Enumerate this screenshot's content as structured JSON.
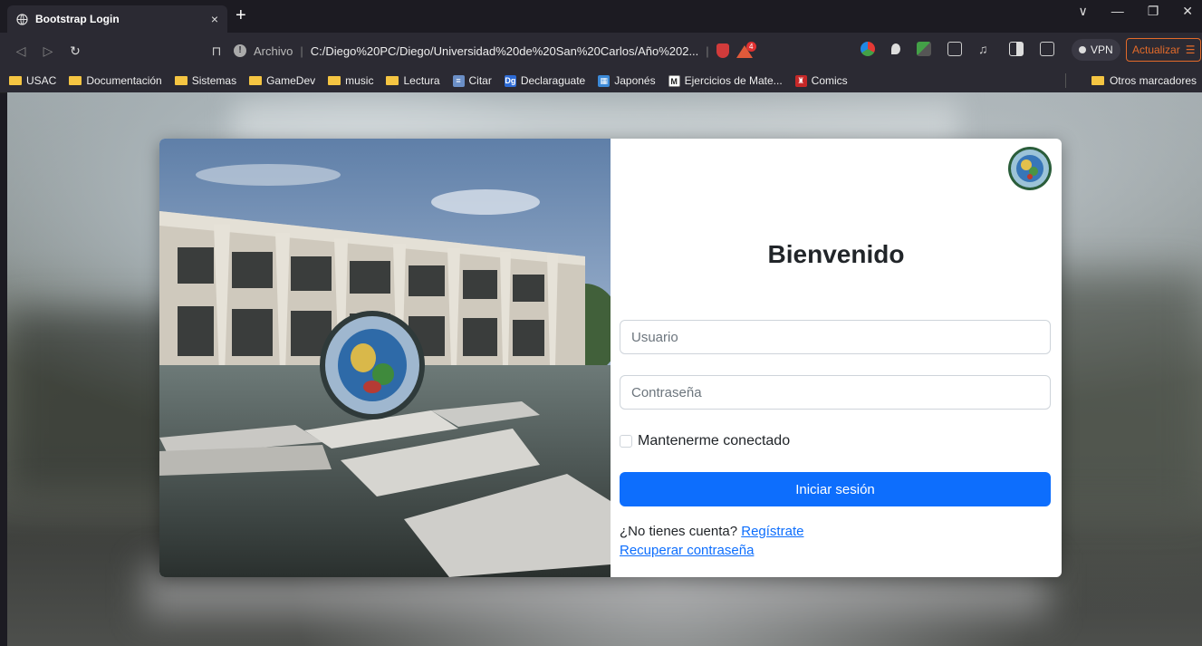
{
  "browser": {
    "tab_title": "Bootstrap Login",
    "tab_close": "×",
    "new_tab": "+",
    "url_label": "Archivo",
    "url_separator": "|",
    "url": "C:/Diego%20PC/Diego/Universidad%20de%20San%20Carlos/Año%202...",
    "brave_badge_count": "4",
    "vpn_label": "VPN",
    "update_label": "Actualizar",
    "window_controls": [
      "∨",
      "—",
      "❐",
      "✕"
    ],
    "bookmarks": [
      {
        "label": "USAC",
        "icon": "folder-icon"
      },
      {
        "label": "Documentación",
        "icon": "folder-icon"
      },
      {
        "label": "Sistemas",
        "icon": "folder-icon"
      },
      {
        "label": "GameDev",
        "icon": "folder-icon"
      },
      {
        "label": "music",
        "icon": "folder-icon"
      },
      {
        "label": "Lectura",
        "icon": "folder-icon"
      },
      {
        "label": "Citar",
        "icon": "citar-icon"
      },
      {
        "label": "Declaraguate",
        "icon": "declaraguate-icon"
      },
      {
        "label": "Japonés",
        "icon": "japones-icon"
      },
      {
        "label": "Ejercicios de Mate...",
        "icon": "m-icon"
      },
      {
        "label": "Comics",
        "icon": "comics-icon"
      }
    ],
    "other_bookmarks": "Otros marcadores"
  },
  "login": {
    "title": "Bienvenido",
    "username_placeholder": "Usuario",
    "password_placeholder": "Contraseña",
    "remember_label": "Mantenerme conectado",
    "submit_label": "Iniciar sesión",
    "no_account_text": "¿No tienes cuenta?",
    "register_link": "Regístrate",
    "recover_link": "Recuperar contraseña"
  },
  "colors": {
    "primary": "#0d6efd",
    "chrome_bg": "#2b2a33",
    "tab_bg": "#1c1b22",
    "update_accent": "#e36b2a"
  }
}
